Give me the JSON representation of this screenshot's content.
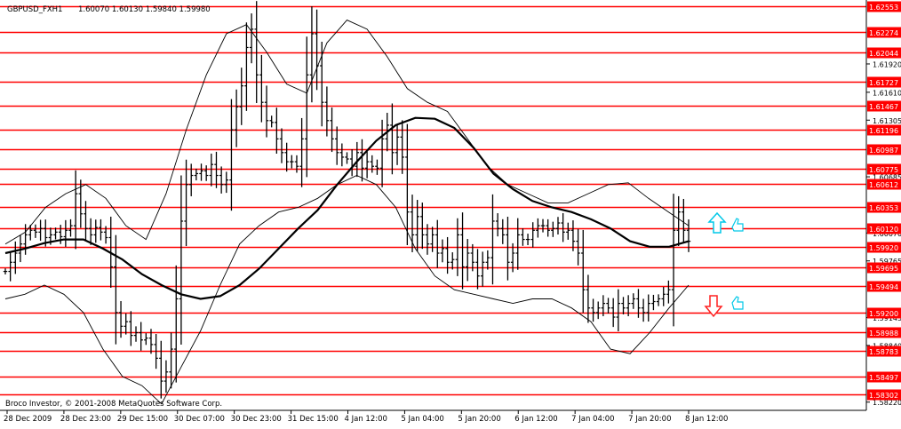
{
  "header": {
    "symbol_text": "GBPUSD_FXH1",
    "ohlc_text": "1.60070 1.60130 1.59840 1.59980"
  },
  "watermark": "Broco Investor, © 2001-2008 MetaQuotes Software Corp.",
  "colors": {
    "background": "#ffffff",
    "hline": "#ff0000",
    "price_label_bg": "#ff0000",
    "price_label_text": "#ffffff",
    "tick_text": "#000000",
    "bars": "#000000",
    "ma": "#000000",
    "bands": "#000000",
    "up_arrow": "#00c8e8",
    "down_arrow": "#ff2020"
  },
  "chart_data": {
    "type": "candlestick",
    "title": "",
    "xlabel": "",
    "ylabel": "",
    "x_tick_labels": [
      "28 Dec 2009",
      "28 Dec 23:00",
      "29 Dec 15:00",
      "30 Dec 07:00",
      "30 Dec 23:00",
      "31 Dec 15:00",
      "4 Jan 12:00",
      "5 Jan 04:00",
      "5 Jan 20:00",
      "6 Jan 12:00",
      "7 Jan 04:00",
      "7 Jan 20:00",
      "8 Jan 12:00"
    ],
    "ylim": [
      1.5813,
      1.626
    ],
    "horizontal_levels": [
      1.62553,
      1.62274,
      1.62044,
      1.61727,
      1.61467,
      1.61196,
      1.60987,
      1.60775,
      1.60612,
      1.60353,
      1.6012,
      1.5992,
      1.59695,
      1.59494,
      1.592,
      1.58988,
      1.58783,
      1.58497,
      1.58302
    ],
    "price_scale_labels": [
      1.6192,
      1.6161,
      1.61305,
      1.60685,
      1.6007,
      1.59765,
      1.59145,
      1.5884,
      1.5822
    ],
    "series": [
      {
        "type": "close_path",
        "values": [
          1.5965,
          1.5975,
          1.5985,
          1.5995,
          1.6005,
          1.601,
          1.6008,
          1.6012,
          1.6002,
          1.6005,
          1.6008,
          1.6003,
          1.601,
          1.6015,
          1.605,
          1.6028,
          1.6012,
          1.6005,
          1.6013,
          1.6008,
          1.6002,
          1.597,
          1.592,
          1.5905,
          1.591,
          1.5895,
          1.5898,
          1.589,
          1.5892,
          1.5885,
          1.587,
          1.5845,
          1.5855,
          1.588,
          1.5935,
          1.602,
          1.606,
          1.607,
          1.6072,
          1.6075,
          1.607,
          1.6082,
          1.607,
          1.606,
          1.6065,
          1.612,
          1.6145,
          1.6168,
          1.621,
          1.623,
          1.618,
          1.615,
          1.613,
          1.6128,
          1.611,
          1.6095,
          1.6085,
          1.6085,
          1.608,
          1.611,
          1.618,
          1.6225,
          1.619,
          1.615,
          1.613,
          1.611,
          1.6095,
          1.609,
          1.6088,
          1.608,
          1.6095,
          1.6078,
          1.6085,
          1.608,
          1.6078,
          1.611,
          1.6125,
          1.6095,
          1.6112,
          1.609,
          1.603,
          1.6005,
          1.6025,
          1.6005,
          1.5995,
          1.6005,
          1.5985,
          1.599,
          1.5975,
          1.5978,
          1.6005,
          1.597,
          1.5985,
          1.5975,
          1.596,
          1.5975,
          1.598,
          1.602,
          1.6012,
          1.6005,
          1.5975,
          1.5985,
          1.6005,
          1.6,
          1.6,
          1.601,
          1.6015,
          1.6015,
          1.601,
          1.6012,
          1.6018,
          1.6008,
          1.601,
          1.5998,
          1.5985,
          1.5945,
          1.5925,
          1.592,
          1.5925,
          1.593,
          1.5925,
          1.5915,
          1.593,
          1.5925,
          1.593,
          1.5935,
          1.5925,
          1.592,
          1.593,
          1.5932,
          1.5935,
          1.594,
          1.5945,
          1.601,
          1.603,
          1.601,
          1.5998
        ]
      },
      {
        "type": "moving_average",
        "values": [
          1.5985,
          1.599,
          1.5996,
          1.6,
          1.6,
          1.599,
          1.5978,
          1.5962,
          1.595,
          1.594,
          1.5935,
          1.5938,
          1.595,
          1.5968,
          1.599,
          1.6012,
          1.6032,
          1.606,
          1.6085,
          1.6108,
          1.6125,
          1.6133,
          1.6132,
          1.6122,
          1.61,
          1.6072,
          1.6055,
          1.6042,
          1.6035,
          1.603,
          1.6022,
          1.6012,
          1.5998,
          1.5992,
          1.5992,
          1.5998
        ]
      },
      {
        "type": "upper_band",
        "values": [
          1.5995,
          1.6008,
          1.6035,
          1.605,
          1.606,
          1.6045,
          1.6015,
          1.6,
          1.605,
          1.612,
          1.618,
          1.6225,
          1.6235,
          1.6205,
          1.617,
          1.616,
          1.6215,
          1.624,
          1.623,
          1.62,
          1.6165,
          1.615,
          1.614,
          1.611,
          1.608,
          1.606,
          1.605,
          1.604,
          1.604,
          1.605,
          1.606,
          1.6062,
          1.6045,
          1.603,
          1.6015
        ]
      },
      {
        "type": "lower_band",
        "values": [
          1.5935,
          1.594,
          1.595,
          1.594,
          1.592,
          1.588,
          1.585,
          1.584,
          1.582,
          1.586,
          1.59,
          1.595,
          1.5995,
          1.6015,
          1.603,
          1.6035,
          1.6045,
          1.606,
          1.607,
          1.606,
          1.6035,
          1.599,
          1.596,
          1.5945,
          1.594,
          1.5935,
          1.593,
          1.5935,
          1.5935,
          1.5925,
          1.591,
          1.588,
          1.5875,
          1.5898,
          1.5925,
          1.595
        ]
      }
    ]
  }
}
